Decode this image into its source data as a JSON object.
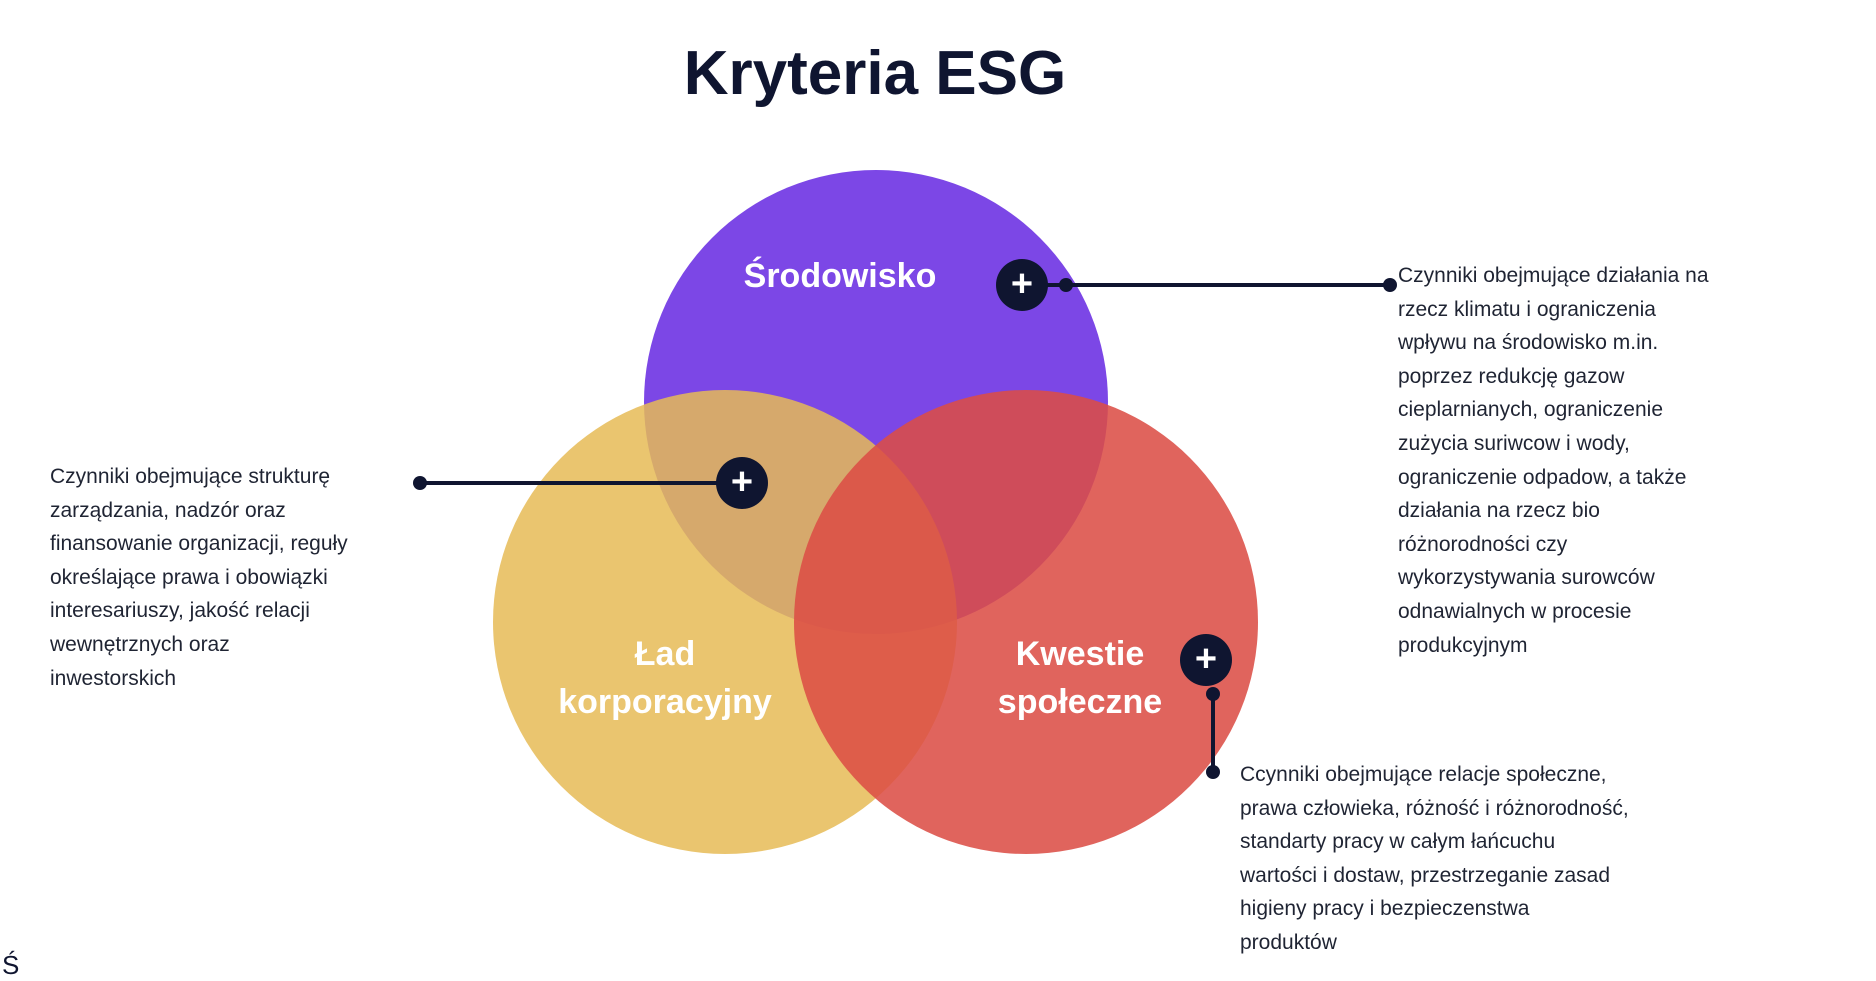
{
  "title": "Kryteria ESG",
  "colors": {
    "environment": "#6a2ee3",
    "governance": "#e6bb56",
    "social": "#db4d45",
    "ink": "#0f1530",
    "connector": "#0f1530"
  },
  "circles": {
    "environment": {
      "label": "Środowisko"
    },
    "governance": {
      "label_line1": "Ład",
      "label_line2": "korporacyjny"
    },
    "social": {
      "label_line1": "Kwestie",
      "label_line2": "społeczne"
    }
  },
  "descriptions": {
    "environment": "Czynniki obejmujące działania  na\nrzecz klimatu i ograniczenia\nwpływu na środowisko m.in.\npoprzez redukcję gazow\ncieplarnianych, ograniczenie\nzużycia suriwcow i wody,\nograniczenie odpadow, a także\ndziałania na rzecz bio\nróżnorodności czy\nwykorzystywania surowców\nodnawialnych w procesie\nprodukcyjnym",
    "governance": "Czynniki obejmujące strukturę\nzarządzania, nadzór oraz\nfinansowanie organizacji, reguły\nokreślające prawa i obowiązki\ninteresariuszy, jakość relacji\nwewnętrznych oraz\ninwestorskich",
    "social": "Ccynniki obejmujące relacje społeczne,\nprawa człowieka, różność i różnorodność,\nstandarty pracy w całym łańcuchu\nwartości i dostaw, przestrzeganie zasad\nhigieny pracy i bezpieczenstwa\nproduktów"
  },
  "plus_symbol": "+",
  "stray_char": "Ś"
}
